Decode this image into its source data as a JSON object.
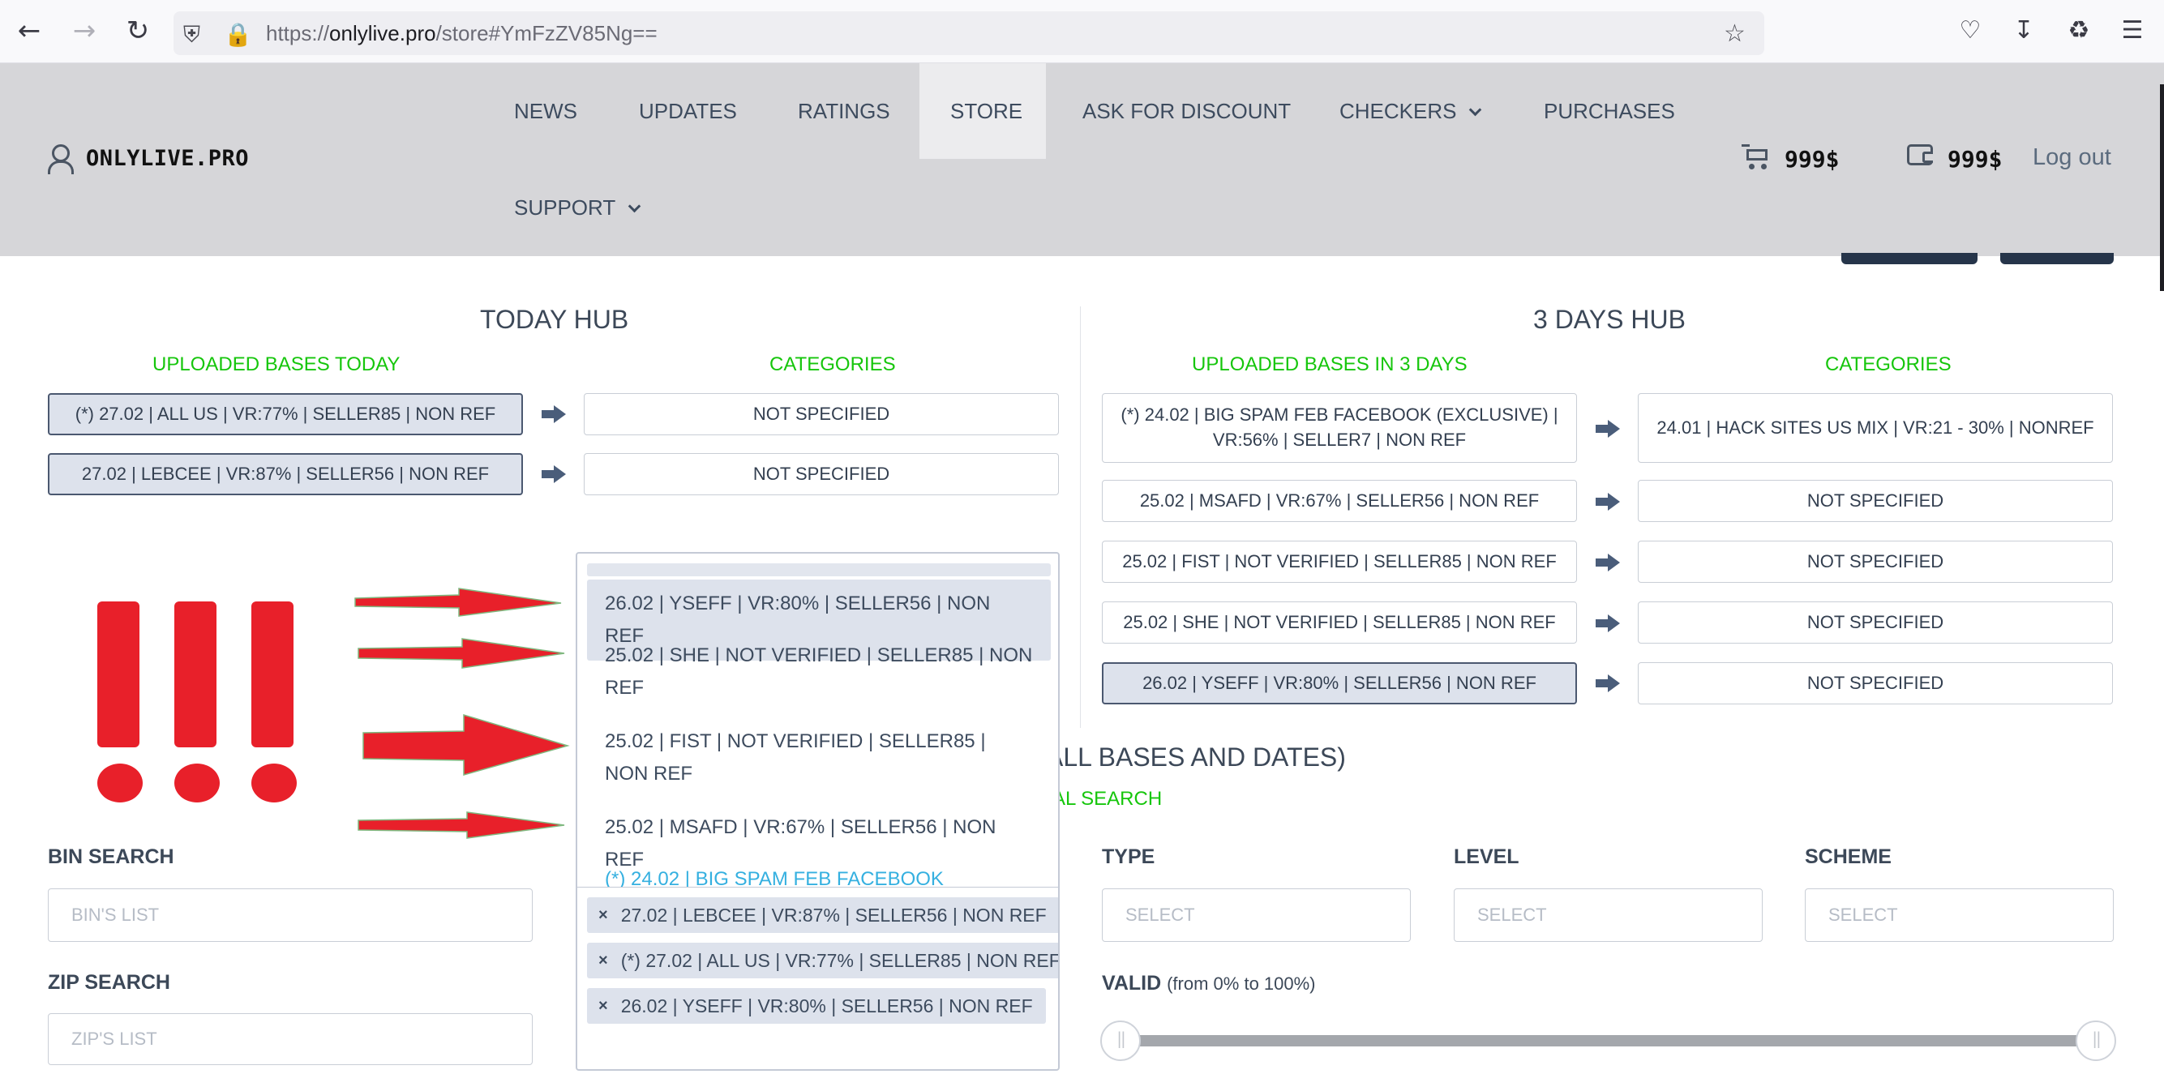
{
  "browser": {
    "url_prefix": "https://",
    "url_host": "onlylive.pro",
    "url_path": "/store#YmFzZV85Ng=="
  },
  "header": {
    "logo": "ONLYLIVE.PRO",
    "menu": [
      {
        "label": "NEWS"
      },
      {
        "label": "UPDATES"
      },
      {
        "label": "RATINGS"
      },
      {
        "label": "STORE"
      },
      {
        "label": "ASK FOR DISCOUNT"
      },
      {
        "label": "CHECKERS"
      },
      {
        "label": "PURCHASES"
      },
      {
        "label": "SUPPORT"
      }
    ],
    "active_item": "STORE",
    "cart_balance": "999$",
    "wallet_balance": "999$",
    "logout": "Log out"
  },
  "today_hub": {
    "title": "TODAY HUB",
    "col_bases": "UPLOADED BASES TODAY",
    "col_categories": "CATEGORIES",
    "rows": [
      {
        "base": "(*) 27.02 | ALL US | VR:77% | SELLER85 | NON REF",
        "category": "NOT SPECIFIED",
        "selected": true
      },
      {
        "base": "27.02 | LEBCEE | VR:87% | SELLER56 | NON REF",
        "category": "NOT SPECIFIED",
        "selected": true
      }
    ]
  },
  "three_days_hub": {
    "title": "3 DAYS HUB",
    "col_bases": "UPLOADED BASES IN 3 DAYS",
    "col_categories": "CATEGORIES",
    "rows": [
      {
        "base": "(*) 24.02 | BIG SPAM FEB FACEBOOK (EXCLUSIVE) | VR:56% | SELLER7 | NON REF",
        "category": "24.01 | HACK SITES US MIX | VR:21 - 30% | NONREF",
        "selected": false
      },
      {
        "base": "25.02 | MSAFD | VR:67% | SELLER56 | NON REF",
        "category": "NOT SPECIFIED",
        "selected": false
      },
      {
        "base": "25.02 | FIST | NOT VERIFIED | SELLER85 | NON REF",
        "category": "NOT SPECIFIED",
        "selected": false
      },
      {
        "base": "25.02 | SHE | NOT VERIFIED | SELLER85 | NON REF",
        "category": "NOT SPECIFIED",
        "selected": false
      },
      {
        "base": "26.02 | YSEFF | VR:80% | SELLER56 | NON REF",
        "category": "NOT SPECIFIED",
        "selected": true
      }
    ]
  },
  "dropdown": {
    "options": [
      {
        "label": "26.02 | YSEFF | VR:80% | SELLER56 | NON REF",
        "highlighted": true
      },
      {
        "label": "25.02 | SHE | NOT VERIFIED | SELLER85 | NON REF",
        "highlighted": false
      },
      {
        "label": "25.02 | FIST | NOT VERIFIED | SELLER85 | NON REF",
        "highlighted": false
      },
      {
        "label": "25.02 | MSAFD | VR:67% | SELLER56 | NON REF",
        "highlighted": false
      },
      {
        "label": "(*) 24.02 | BIG SPAM FEB FACEBOOK",
        "highlighted": false
      }
    ],
    "selected_tags": [
      "27.02 | LEBCEE | VR:87% | SELLER56 | NON REF",
      "(*) 27.02 | ALL US | VR:77% | SELLER85 | NON REF",
      "26.02 | YSEFF | VR:80% | SELLER56 | NON REF"
    ],
    "remove_symbol": "×"
  },
  "search": {
    "title_visible": "ALL BASES AND DATES)",
    "subtitle_visible": "AL SEARCH",
    "bin_label": "BIN SEARCH",
    "bin_placeholder": "BIN'S LIST",
    "zip_label": "ZIP SEARCH",
    "zip_placeholder": "ZIP'S LIST",
    "type_label": "TYPE",
    "type_placeholder": "SELECT",
    "level_label": "LEVEL",
    "level_placeholder": "SELECT",
    "scheme_label": "SCHEME",
    "scheme_placeholder": "SELECT",
    "valid_label": "VALID",
    "valid_note": "(from 0% to 100%)",
    "valid_range": [
      0,
      100
    ]
  },
  "colors": {
    "accent_green": "#16c60c",
    "header_bg": "#d6d6d9",
    "annotation_red": "#e8202a",
    "selected_bg": "#dde2ec"
  }
}
